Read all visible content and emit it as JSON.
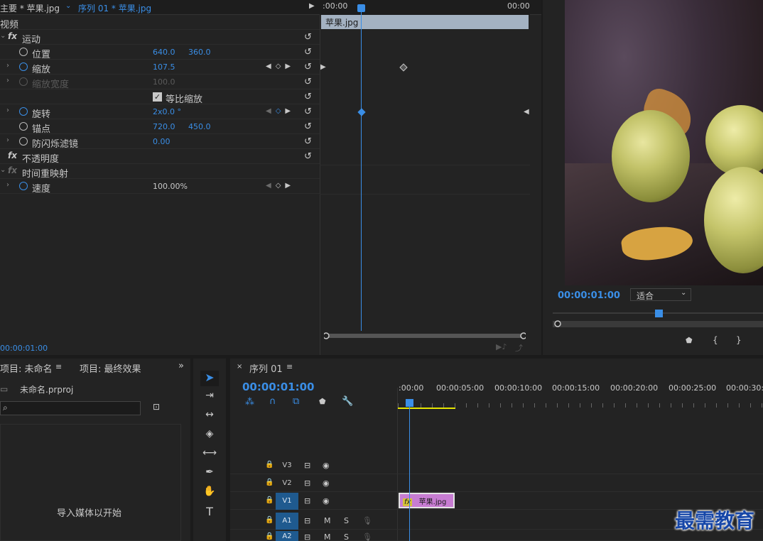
{
  "effect_controls": {
    "tabs": [
      "主要 * 苹果.jpg",
      "序列 01 * 苹果.jpg"
    ],
    "section_video": "视频",
    "motion": "运动",
    "properties": [
      {
        "name": "位置",
        "v1": "640.0",
        "v2": "360.0"
      },
      {
        "name": "缩放",
        "v1": "107.5"
      },
      {
        "name": "缩放宽度",
        "v1": "100.0"
      },
      {
        "name": "等比缩放"
      },
      {
        "name": "旋转",
        "v1": "2x0.0 °"
      },
      {
        "name": "锚点",
        "v1": "720.0",
        "v2": "450.0"
      },
      {
        "name": "防闪烁滤镜",
        "v1": "0.00"
      }
    ],
    "opacity": "不透明度",
    "time_remap": "时间重映射",
    "speed": {
      "name": "速度",
      "value": "100.00%"
    },
    "ruler_start": ":00:00",
    "ruler_end": "00:00",
    "clip_name": "苹果.jpg",
    "current_time": "00:00:01:00"
  },
  "program_monitor": {
    "timecode": "00:00:01:00",
    "fit": "适合"
  },
  "project": {
    "tab_active": "项目: 未命名",
    "tab_other": "项目: 最终效果",
    "file": "未命名.prproj",
    "empty_text": "导入媒体以开始"
  },
  "timeline": {
    "close": "×",
    "title": "序列 01",
    "timecode": "00:00:01:00",
    "ticks": [
      ":00:00",
      "00:00:05:00",
      "00:00:10:00",
      "00:00:15:00",
      "00:00:20:00",
      "00:00:25:00",
      "00:00:30:0"
    ],
    "tracks": [
      "V3",
      "V2",
      "V1",
      "A1",
      "A2"
    ],
    "clip": "苹果.jpg",
    "clip_fx": "fx"
  },
  "watermark": "最需教育",
  "colors": {
    "accent": "#3a8ee6",
    "clip": "#c77cd2",
    "selected_track": "#1f5a8f"
  }
}
